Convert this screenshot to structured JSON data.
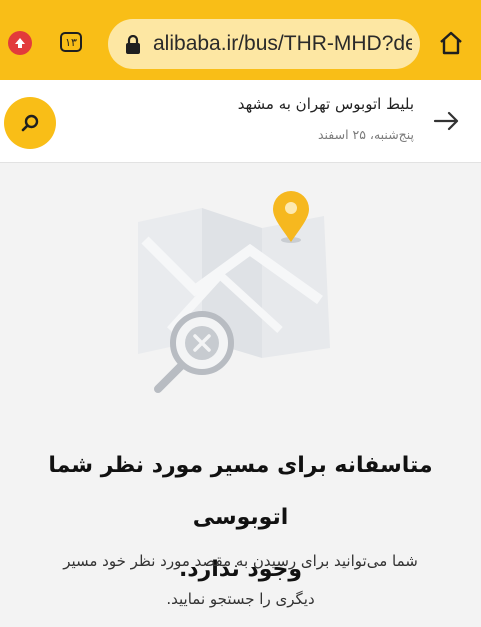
{
  "browser": {
    "url": "alibaba.ir/bus/THR-MHD?de",
    "tab_count": "۱۳",
    "accent": "#f9be17"
  },
  "header": {
    "title": "بلیط اتوبوس تهران به مشهد",
    "subtitle": "پنج‌شنبه، ۲۵ اسفند"
  },
  "empty_state": {
    "title_line1": "متاسفانه برای مسیر مورد نظر شما اتوبوسی",
    "title_line2": "وجود ندارد.",
    "body_line1": "شما می‌توانید برای رسیدن به مقصد مورد نظر خود مسیر",
    "body_line2": "دیگری را جستجو نمایید."
  },
  "icons": [
    "arrow-up-icon",
    "tabs-icon",
    "lock-icon",
    "home-icon",
    "search-icon",
    "back-arrow-icon",
    "map-pin-icon",
    "map-illustration",
    "magnifier-x-icon"
  ]
}
